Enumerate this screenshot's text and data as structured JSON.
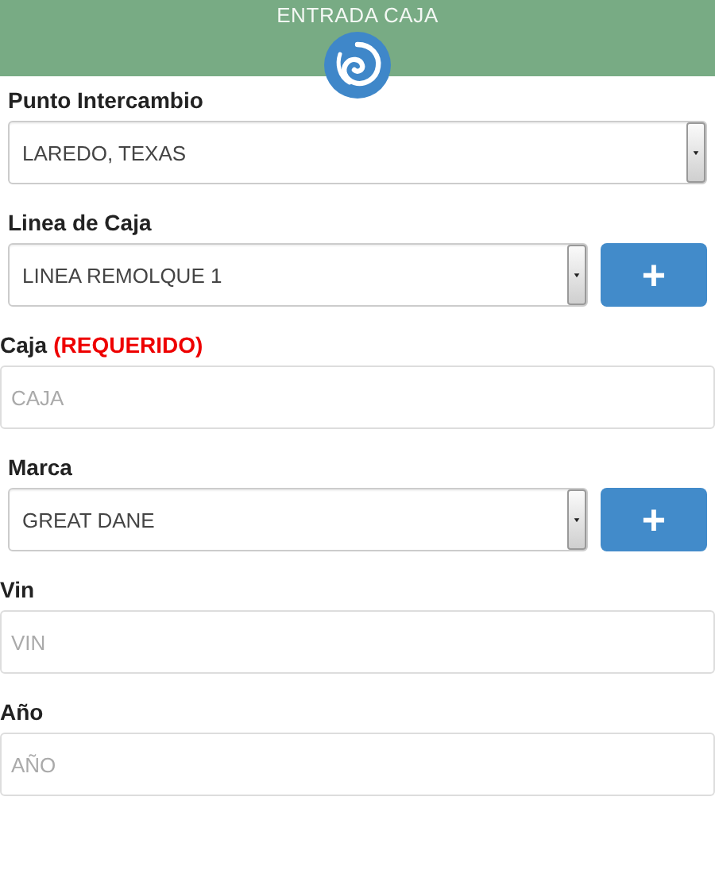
{
  "header": {
    "title": "ENTRADA CAJA"
  },
  "fields": [
    {
      "kind": "select",
      "label": "Punto Intercambio",
      "value": "LAREDO, TEXAS"
    },
    {
      "kind": "select_add",
      "label": "Linea de Caja",
      "value": "LINEA REMOLQUE 1",
      "button": "+"
    },
    {
      "kind": "input",
      "label": "Caja",
      "required_note": "(REQUERIDO)",
      "placeholder": "CAJA"
    },
    {
      "kind": "select_add",
      "label": "Marca",
      "value": "GREAT DANE",
      "button": "+"
    },
    {
      "kind": "input",
      "label": "Vin",
      "placeholder": "VIN"
    },
    {
      "kind": "input",
      "label": "Año",
      "placeholder": "AÑO"
    }
  ]
}
